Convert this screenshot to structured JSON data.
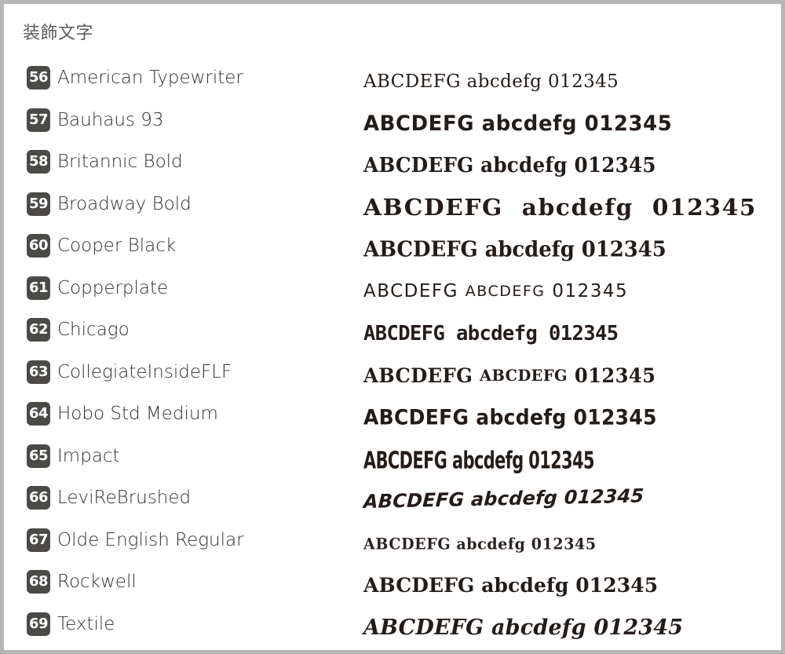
{
  "page": {
    "title": "装飾文字",
    "background_color": "#ffffff",
    "frame_color": "#b6b6b6",
    "badge_color": "#4c4a47",
    "badge_text_color": "#ffffff",
    "label_color": "#33312f",
    "title_color": "#5b5b5b",
    "sample_color": "#231c18"
  },
  "sample_string": "ABCDEFG abcdefg 012345",
  "fonts": [
    {
      "index": "56",
      "name": "American Typewriter",
      "sample": "ABCDEFG abcdefg 012345",
      "style_class": "s-american-typewriter"
    },
    {
      "index": "57",
      "name": "Bauhaus 93",
      "sample": "ABCDEFG abcdefg 012345",
      "style_class": "s-bauhaus"
    },
    {
      "index": "58",
      "name": "Britannic Bold",
      "sample": "ABCDEFG abcdefg 012345",
      "style_class": "s-britannic"
    },
    {
      "index": "59",
      "name": "Broadway Bold",
      "sample": "ABCDEFG  abcdefg  012345",
      "style_class": "s-broadway"
    },
    {
      "index": "60",
      "name": "Cooper Black",
      "sample": "ABCDEFG abcdefg 012345",
      "style_class": "s-cooper-black"
    },
    {
      "index": "61",
      "name": "Copperplate",
      "sample": "ABCDEFG ABCDEFG 012345",
      "sample_upper": "ABCDEFG ",
      "sample_lower": "ABCDEFG",
      "sample_digits": " 012345",
      "style_class": "s-copperplate",
      "smallcaps": true
    },
    {
      "index": "62",
      "name": "Chicago",
      "sample": "ABCDEFG abcdefg 012345",
      "style_class": "s-chicago"
    },
    {
      "index": "63",
      "name": "CollegiateInsideFLF",
      "sample": "ABCDEFG ABCDEFG 012345",
      "sample_upper": "ABCDEFG ",
      "sample_lower": "ABCDEFG",
      "sample_digits": " 012345",
      "style_class": "s-collegiate",
      "smallcaps": true
    },
    {
      "index": "64",
      "name": "Hobo Std Medium",
      "sample": "ABCDEFG abcdefg 012345",
      "style_class": "s-hobo"
    },
    {
      "index": "65",
      "name": "Impact",
      "sample": "ABCDEFG abcdefg 012345",
      "style_class": "s-impact"
    },
    {
      "index": "66",
      "name": "LeviReBrushed",
      "sample": "ABCDEFG abcdefg 012345",
      "style_class": "s-levi"
    },
    {
      "index": "67",
      "name": "Olde English Regular",
      "sample": "ABCDEFG abcdefg 012345",
      "style_class": "s-olde-english"
    },
    {
      "index": "68",
      "name": "Rockwell",
      "sample": "ABCDEFG abcdefg 012345",
      "style_class": "s-rockwell"
    },
    {
      "index": "69",
      "name": "Textile",
      "sample": "ABCDEFG abcdefg 012345",
      "style_class": "s-textile"
    }
  ]
}
